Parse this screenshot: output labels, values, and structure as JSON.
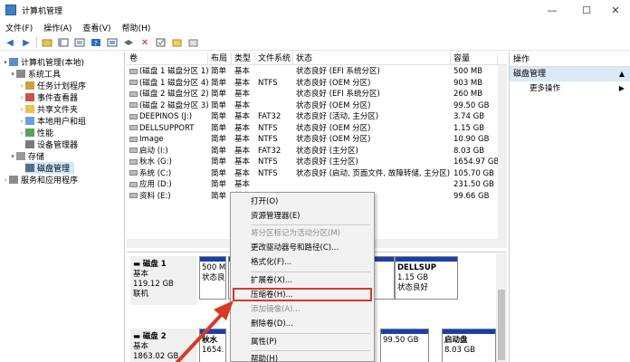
{
  "window": {
    "title": "计算机管理",
    "minimize_glyph": "—",
    "maximize_glyph": "☐",
    "close_glyph": "✕"
  },
  "menu": [
    "文件(F)",
    "操作(A)",
    "查看(V)",
    "帮助(H)"
  ],
  "tree": {
    "root": "计算机管理(本地)",
    "system_tools": "系统工具",
    "task_scheduler": "任务计划程序",
    "event_viewer": "事件查看器",
    "shared_folders": "共享文件夹",
    "local_users": "本地用户和组",
    "performance": "性能",
    "device_manager": "设备管理器",
    "storage": "存储",
    "disk_management": "磁盘管理",
    "services_apps": "服务和应用程序"
  },
  "volume_table": {
    "headers": [
      "卷",
      "布局",
      "类型",
      "文件系统",
      "状态",
      "容量"
    ],
    "rows": [
      [
        "(磁盘 1 磁盘分区 1)",
        "简单",
        "基本",
        "",
        "状态良好 (EFI 系统分区)",
        "500 MB"
      ],
      [
        "(磁盘 1 磁盘分区 4)",
        "简单",
        "基本",
        "NTFS",
        "状态良好 (OEM 分区)",
        "903 MB"
      ],
      [
        "(磁盘 2 磁盘分区 2)",
        "简单",
        "基本",
        "",
        "状态良好 (EFI 系统分区)",
        "260 MB"
      ],
      [
        "(磁盘 2 磁盘分区 3)",
        "简单",
        "基本",
        "",
        "状态良好 (OEM 分区)",
        "99.50 GB"
      ],
      [
        "DEEPINOS (J:)",
        "简单",
        "基本",
        "FAT32",
        "状态良好 (活动, 主分区)",
        "3.74 GB"
      ],
      [
        "DELLSUPPORT",
        "简单",
        "基本",
        "NTFS",
        "状态良好 (OEM 分区)",
        "1.15 GB"
      ],
      [
        "Image",
        "简单",
        "基本",
        "NTFS",
        "状态良好 (OEM 分区)",
        "10.90 GB"
      ],
      [
        "启动 (I:)",
        "简单",
        "基本",
        "FAT32",
        "状态良好 (主分区)",
        "8.03 GB"
      ],
      [
        "秋水 (G:)",
        "简单",
        "基本",
        "NTFS",
        "状态良好 (主分区)",
        "1654.97 GB"
      ],
      [
        "系统 (C:)",
        "简单",
        "基本",
        "NTFS",
        "状态良好 (启动, 页面文件, 故障转储, 主分区)",
        "105.70 GB"
      ],
      [
        "应用 (D:)",
        "简单",
        "基本",
        "",
        "",
        "231.50 GB"
      ],
      [
        "资料 (E:)",
        "简单",
        "基本",
        "",
        "",
        "99.66 GB"
      ]
    ]
  },
  "disks": [
    {
      "name": "磁盘 1",
      "type": "基本",
      "size": "119.12 GB",
      "status": "联机",
      "partitions": [
        {
          "title": "",
          "line1": "500 M",
          "line2": "状态良"
        },
        {
          "title": "",
          "line1": "",
          "line2": ""
        },
        {
          "title": "DELLSUP",
          "line1": "1.15 GB",
          "line2": "状态良好"
        }
      ]
    },
    {
      "name": "磁盘 2",
      "type": "基本",
      "size": "1863.02 GB",
      "status": "",
      "partitions": [
        {
          "title": "秋水",
          "line1": "1654.",
          "line2": ""
        },
        {
          "title": "",
          "line1": "99.50 GB",
          "line2": ""
        },
        {
          "title": "启动盘",
          "line1": "8.03 GB",
          "line2": ""
        }
      ]
    }
  ],
  "context_menu": {
    "items": [
      {
        "label": "打开(O)",
        "disabled": false
      },
      {
        "label": "资源管理器(E)",
        "disabled": false
      },
      {
        "label": "将分区标记为活动分区(M)",
        "disabled": true
      },
      {
        "label": "更改驱动器号和路径(C)...",
        "disabled": false
      },
      {
        "label": "格式化(F)...",
        "disabled": false
      },
      {
        "label": "扩展卷(X)...",
        "disabled": false
      },
      {
        "label": "压缩卷(H)...",
        "disabled": false
      },
      {
        "label": "添加镜像(A)...",
        "disabled": true
      },
      {
        "label": "删除卷(D)...",
        "disabled": false
      },
      {
        "label": "属性(P)",
        "disabled": false
      },
      {
        "label": "帮助(H)",
        "disabled": false
      }
    ],
    "highlighted_label": "压缩卷(H)...",
    "highlight_color": "#d63a24"
  },
  "operations": {
    "header": "操作",
    "section": "磁盘管理",
    "more": "更多操作"
  },
  "colors": {
    "accent": "#1c3ea8",
    "selection": "#cce8ff",
    "annotation": "#d63a24"
  }
}
